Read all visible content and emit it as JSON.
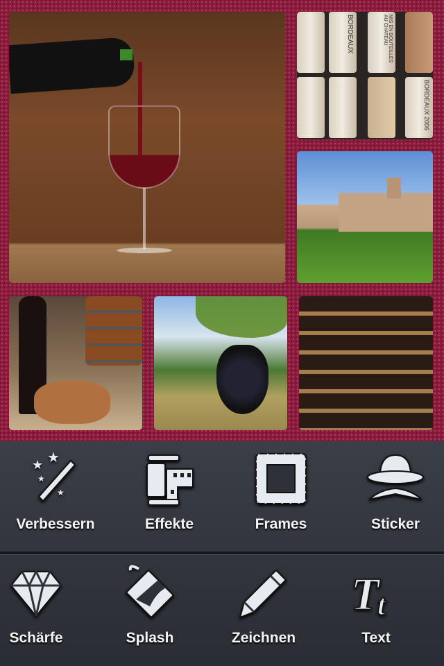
{
  "collage": {
    "photos": [
      "wine-pouring",
      "wine-corks",
      "chateau-vineyard",
      "wine-bread-grapes",
      "grape-vine",
      "wine-cellar"
    ],
    "background_color": "#8c1c3e"
  },
  "corks": [
    "BORDEAUX",
    "2006",
    "MIS EN BOUTEILLES AU CHATEAU",
    "BORDEAUX 2006"
  ],
  "toolbar": {
    "row1": [
      {
        "label": "Verbessern",
        "icon": "magic-wand-icon"
      },
      {
        "label": "Effekte",
        "icon": "film-roll-icon"
      },
      {
        "label": "Frames",
        "icon": "stamp-frame-icon"
      },
      {
        "label": "Sticker",
        "icon": "hat-mustache-icon"
      }
    ],
    "row2": [
      {
        "label": "Schärfe",
        "icon": "diamond-icon"
      },
      {
        "label": "Splash",
        "icon": "paint-bucket-icon"
      },
      {
        "label": "Zeichnen",
        "icon": "pencil-icon"
      },
      {
        "label": "Text",
        "icon": "text-tt-icon"
      }
    ]
  }
}
